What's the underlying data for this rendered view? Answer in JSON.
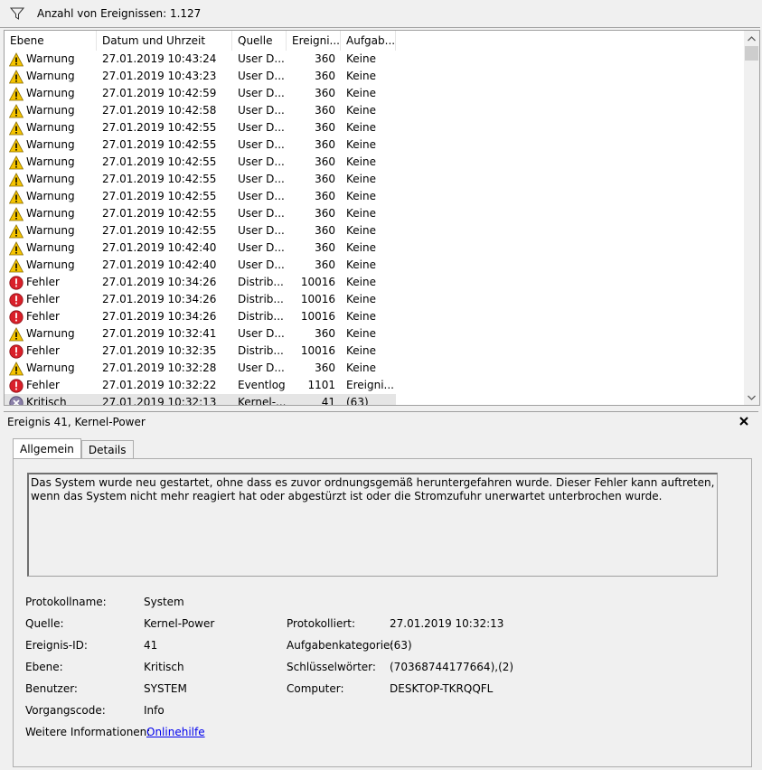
{
  "filterbar": {
    "count_text": "Anzahl von Ereignissen: 1.127"
  },
  "columns": [
    "Ebene",
    "Datum und Uhrzeit",
    "Quelle",
    "Ereigni...",
    "Aufgab..."
  ],
  "rows": [
    {
      "level": "Warnung",
      "type": "warning",
      "date": "27.01.2019 10:43:24",
      "source": "User D...",
      "id": "360",
      "task": "Keine"
    },
    {
      "level": "Warnung",
      "type": "warning",
      "date": "27.01.2019 10:43:23",
      "source": "User D...",
      "id": "360",
      "task": "Keine"
    },
    {
      "level": "Warnung",
      "type": "warning",
      "date": "27.01.2019 10:42:59",
      "source": "User D...",
      "id": "360",
      "task": "Keine"
    },
    {
      "level": "Warnung",
      "type": "warning",
      "date": "27.01.2019 10:42:58",
      "source": "User D...",
      "id": "360",
      "task": "Keine"
    },
    {
      "level": "Warnung",
      "type": "warning",
      "date": "27.01.2019 10:42:55",
      "source": "User D...",
      "id": "360",
      "task": "Keine"
    },
    {
      "level": "Warnung",
      "type": "warning",
      "date": "27.01.2019 10:42:55",
      "source": "User D...",
      "id": "360",
      "task": "Keine"
    },
    {
      "level": "Warnung",
      "type": "warning",
      "date": "27.01.2019 10:42:55",
      "source": "User D...",
      "id": "360",
      "task": "Keine"
    },
    {
      "level": "Warnung",
      "type": "warning",
      "date": "27.01.2019 10:42:55",
      "source": "User D...",
      "id": "360",
      "task": "Keine"
    },
    {
      "level": "Warnung",
      "type": "warning",
      "date": "27.01.2019 10:42:55",
      "source": "User D...",
      "id": "360",
      "task": "Keine"
    },
    {
      "level": "Warnung",
      "type": "warning",
      "date": "27.01.2019 10:42:55",
      "source": "User D...",
      "id": "360",
      "task": "Keine"
    },
    {
      "level": "Warnung",
      "type": "warning",
      "date": "27.01.2019 10:42:55",
      "source": "User D...",
      "id": "360",
      "task": "Keine"
    },
    {
      "level": "Warnung",
      "type": "warning",
      "date": "27.01.2019 10:42:40",
      "source": "User D...",
      "id": "360",
      "task": "Keine"
    },
    {
      "level": "Warnung",
      "type": "warning",
      "date": "27.01.2019 10:42:40",
      "source": "User D...",
      "id": "360",
      "task": "Keine"
    },
    {
      "level": "Fehler",
      "type": "error",
      "date": "27.01.2019 10:34:26",
      "source": "Distrib...",
      "id": "10016",
      "task": "Keine"
    },
    {
      "level": "Fehler",
      "type": "error",
      "date": "27.01.2019 10:34:26",
      "source": "Distrib...",
      "id": "10016",
      "task": "Keine"
    },
    {
      "level": "Fehler",
      "type": "error",
      "date": "27.01.2019 10:34:26",
      "source": "Distrib...",
      "id": "10016",
      "task": "Keine"
    },
    {
      "level": "Warnung",
      "type": "warning",
      "date": "27.01.2019 10:32:41",
      "source": "User D...",
      "id": "360",
      "task": "Keine"
    },
    {
      "level": "Fehler",
      "type": "error",
      "date": "27.01.2019 10:32:35",
      "source": "Distrib...",
      "id": "10016",
      "task": "Keine"
    },
    {
      "level": "Warnung",
      "type": "warning",
      "date": "27.01.2019 10:32:28",
      "source": "User D...",
      "id": "360",
      "task": "Keine"
    },
    {
      "level": "Fehler",
      "type": "error",
      "date": "27.01.2019 10:32:22",
      "source": "Eventlog",
      "id": "1101",
      "task": "Ereigni..."
    },
    {
      "level": "Kritisch",
      "type": "critical",
      "date": "27.01.2019 10:32:13",
      "source": "Kernel-...",
      "id": "41",
      "task": "(63)",
      "selected": true
    }
  ],
  "detail": {
    "header": "Ereignis 41, Kernel-Power",
    "tabs": [
      "Allgemein",
      "Details"
    ],
    "description": "Das System wurde neu gestartet, ohne dass es zuvor ordnungsgemäß heruntergefahren wurde. Dieser Fehler kann auftreten, wenn das System nicht mehr reagiert hat oder abgestürzt ist oder die Stromzufuhr unerwartet unterbrochen wurde.",
    "fields": {
      "protokollname_label": "Protokollname:",
      "protokollname": "System",
      "quelle_label": "Quelle:",
      "quelle": "Kernel-Power",
      "protokolliert_label": "Protokolliert:",
      "protokolliert": "27.01.2019 10:32:13",
      "ereignis_id_label": "Ereignis-ID:",
      "ereignis_id": "41",
      "aufgabenkategorie_label": "Aufgabenkategorie:",
      "aufgabenkategorie": "(63)",
      "ebene_label": "Ebene:",
      "ebene": "Kritisch",
      "schluesselwoerter_label": "Schlüsselwörter:",
      "schluesselwoerter": "(70368744177664),(2)",
      "benutzer_label": "Benutzer:",
      "benutzer": "SYSTEM",
      "computer_label": "Computer:",
      "computer": "DESKTOP-TKRQQFL",
      "vorgangscode_label": "Vorgangscode:",
      "vorgangscode": "Info",
      "weitere_label": "Weitere Informationen:",
      "weitere_link": "Onlinehilfe"
    }
  },
  "colors": {
    "warning": "#f5c400",
    "error": "#d9202a",
    "critical": "#8a7fa8",
    "selected_row": "#e5e5e5",
    "link": "#0000ee"
  },
  "icons": {
    "filter": "filter-funnel-icon",
    "warning": "warning-triangle-icon",
    "error": "error-circle-icon",
    "critical": "critical-x-circle-icon",
    "close": "close-icon"
  }
}
